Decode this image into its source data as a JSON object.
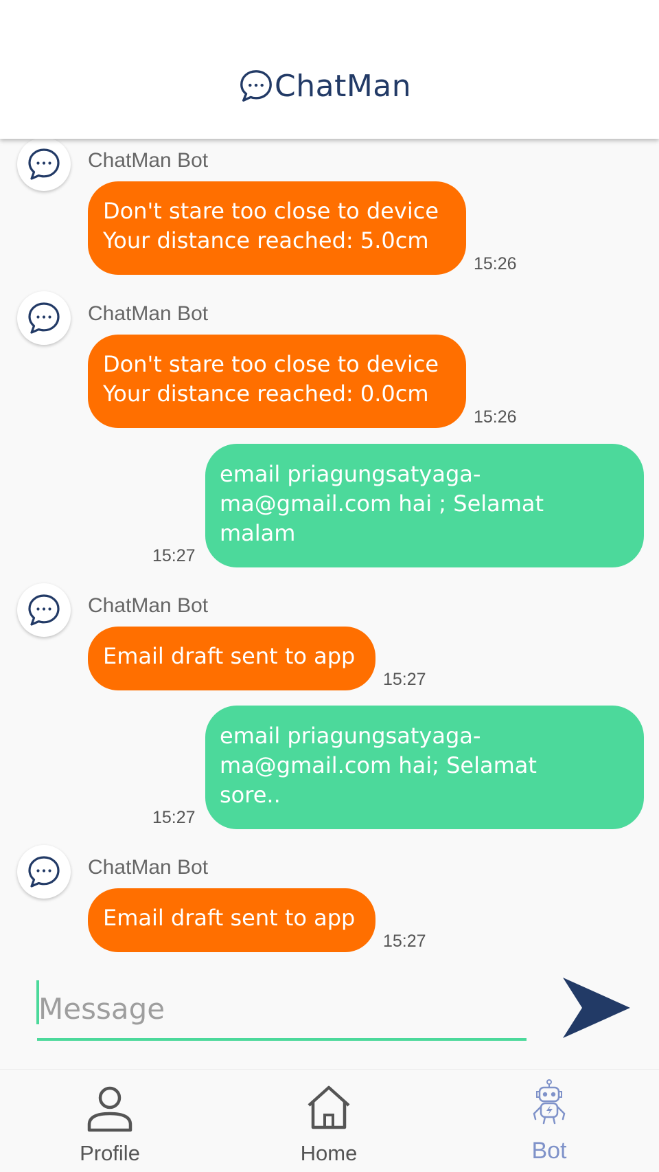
{
  "app": {
    "title": "ChatMan"
  },
  "messages": [
    {
      "sender": "ChatMan Bot",
      "lines": [
        "Don't stare too close to device",
        "Your distance reached: 5.0cm"
      ],
      "time": "15:26"
    },
    {
      "sender": "ChatMan Bot",
      "lines": [
        "Don't stare too close to device",
        "Your distance reached: 0.0cm"
      ],
      "time": "15:26"
    },
    {
      "lines": [
        "email priagungsatyaga-",
        "ma@gmail.com hai ; Selamat",
        "malam"
      ],
      "time": "15:27"
    },
    {
      "sender": "ChatMan Bot",
      "lines": [
        "Email draft sent to app"
      ],
      "time": "15:27"
    },
    {
      "lines": [
        "email priagungsatyaga-",
        "ma@gmail.com hai; Selamat",
        "sore.."
      ],
      "time": "15:27"
    },
    {
      "sender": "ChatMan Bot",
      "lines": [
        "Email draft sent to app"
      ],
      "time": "15:27"
    }
  ],
  "composer": {
    "placeholder": "Message",
    "value": ""
  },
  "nav": {
    "items": [
      {
        "label": "Profile",
        "icon": "person-icon"
      },
      {
        "label": "Home",
        "icon": "home-icon"
      },
      {
        "label": "Bot",
        "icon": "robot-icon",
        "active": true
      }
    ]
  },
  "colors": {
    "bot_bubble": "#ff6f00",
    "user_bubble": "#4cd99b",
    "brand": "#223a66",
    "active_nav": "#7f92c9"
  }
}
